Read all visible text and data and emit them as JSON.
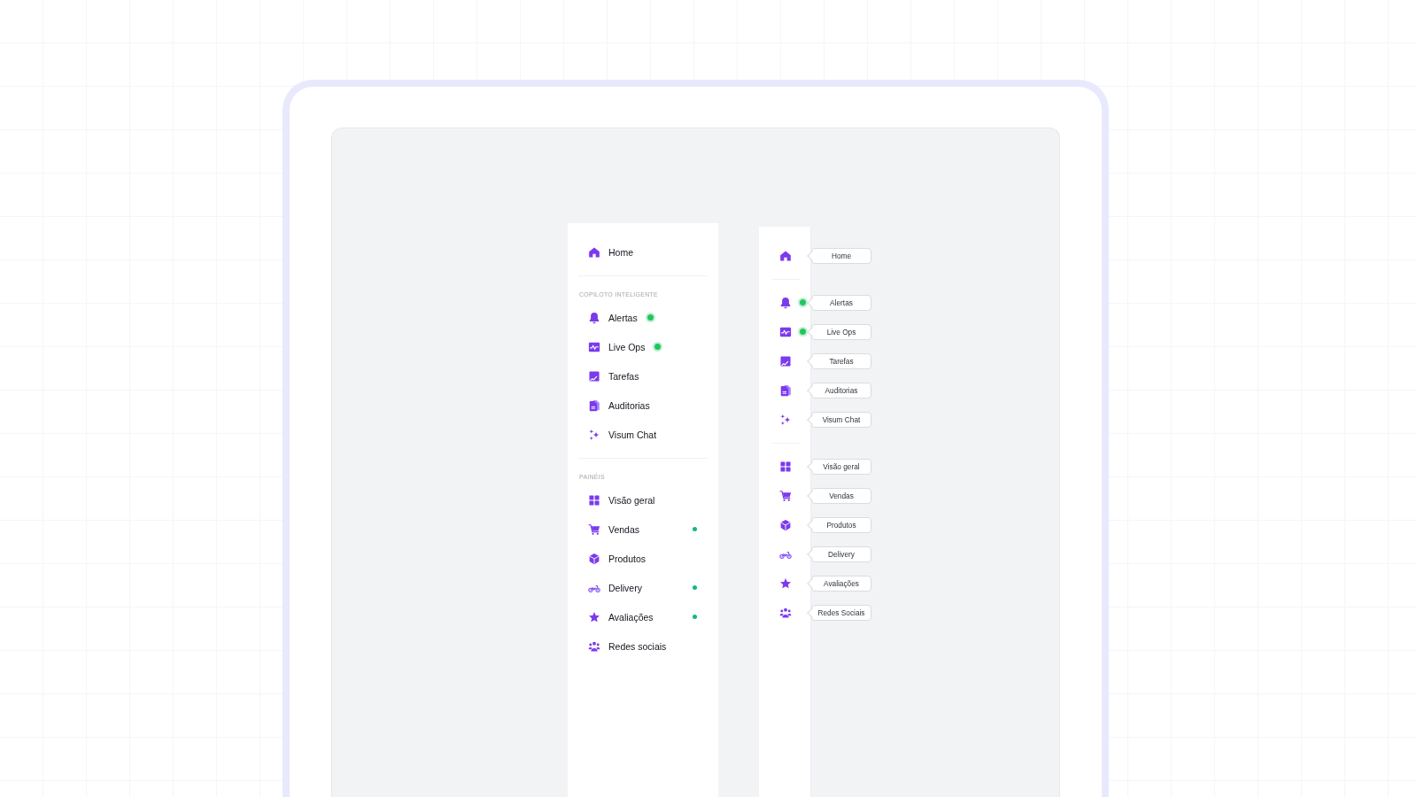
{
  "sidebar": {
    "sections": [
      {
        "items": [
          {
            "label": "Home",
            "selected": false,
            "kind": "plain"
          }
        ]
      },
      {
        "title": "COPILOTO INTELIGENTE",
        "items": [
          {
            "label": "Alertas",
            "selected": false,
            "kind": "live"
          },
          {
            "label": "Live Ops",
            "selected": false,
            "kind": "live"
          },
          {
            "label": "Tarefas",
            "selected": false,
            "kind": "plain"
          },
          {
            "label": "Auditorias",
            "selected": false,
            "kind": "plain"
          },
          {
            "label": "Visum Chat",
            "selected": false,
            "kind": "plain"
          }
        ]
      },
      {
        "title": "PAINÉIS",
        "items": [
          {
            "label": "Visão geral",
            "selected": false,
            "kind": "plain"
          },
          {
            "label": "Vendas",
            "selected": false,
            "kind": "dot"
          },
          {
            "label": "Produtos",
            "selected": false,
            "kind": "plain"
          },
          {
            "label": "Delivery",
            "selected": false,
            "kind": "dot"
          },
          {
            "label": "Avaliações",
            "selected": false,
            "kind": "dot"
          },
          {
            "label": "Redes sociais",
            "selected": false,
            "kind": "plain"
          }
        ]
      }
    ]
  },
  "collapsed_sidebar": {
    "sections": [
      {
        "items": [
          {
            "tooltip": "Home",
            "selected": false,
            "kind": "plain"
          }
        ]
      },
      {
        "items": [
          {
            "tooltip": "Alertas",
            "selected": false,
            "kind": "live"
          },
          {
            "tooltip": "Live Ops",
            "selected": false,
            "kind": "live"
          },
          {
            "tooltip": "Tarefas",
            "selected": false,
            "kind": "plain"
          },
          {
            "tooltip": "Auditorias",
            "selected": false,
            "kind": "plain"
          },
          {
            "tooltip": "Visum Chat",
            "selected": false,
            "kind": "plain"
          }
        ]
      },
      {
        "items": [
          {
            "tooltip": "Visão geral",
            "selected": false,
            "kind": "plain"
          },
          {
            "tooltip": "Vendas",
            "selected": false,
            "kind": "plain"
          },
          {
            "tooltip": "Produtos",
            "selected": false,
            "kind": "plain"
          },
          {
            "tooltip": "Delivery",
            "selected": false,
            "kind": "plain"
          },
          {
            "tooltip": "Avaliações",
            "selected": false,
            "kind": "plain"
          },
          {
            "tooltip": "Redes Sociais",
            "selected": false,
            "kind": "plain"
          }
        ]
      }
    ]
  }
}
